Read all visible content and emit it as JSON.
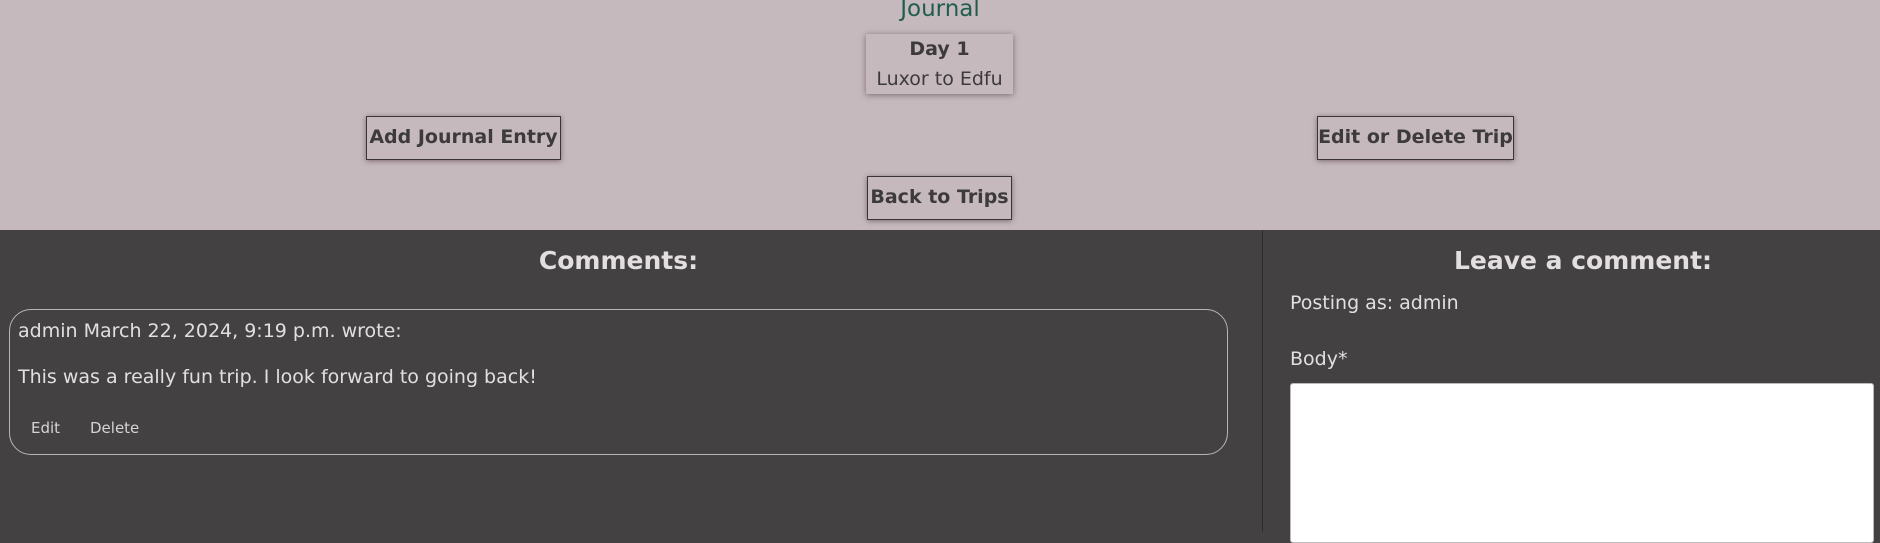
{
  "header": {
    "title": "Journal",
    "day_label": "Day 1",
    "route": "Luxor to Edfu",
    "add_entry_label": "Add Journal Entry",
    "edit_trip_label": "Edit or Delete Trip",
    "back_label": "Back to Trips"
  },
  "comments": {
    "heading": "Comments:",
    "items": [
      {
        "meta": "admin March 22, 2024, 9:19 p.m. wrote:",
        "body": "This was a really fun trip. I look forward to going back!",
        "edit_label": "Edit",
        "delete_label": "Delete"
      }
    ]
  },
  "leave_comment": {
    "heading": "Leave a comment:",
    "posting_as": "Posting as: admin",
    "body_label": "Body*",
    "body_value": ""
  },
  "colors": {
    "header_bg": "#c6b9bd",
    "page_bg": "#444142",
    "title_green": "#1f5d4f",
    "text_light": "#e3dfe0"
  }
}
